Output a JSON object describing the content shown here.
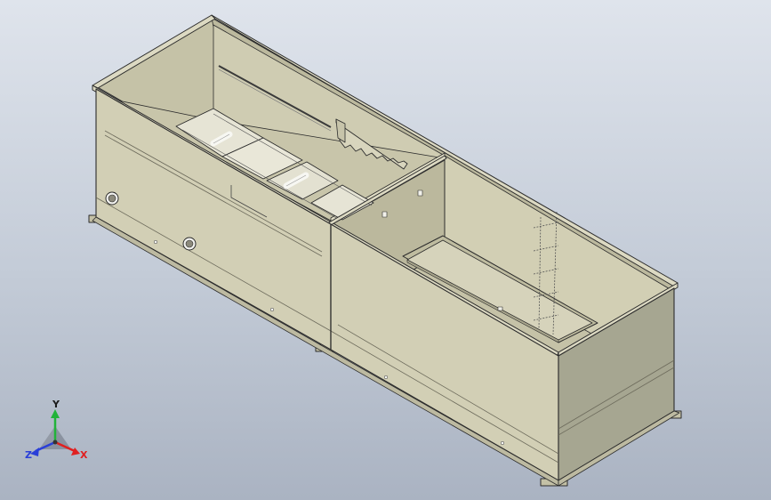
{
  "triad": {
    "x_label": "X",
    "y_label": "Y",
    "z_label": "Z",
    "x_color": "#e02020",
    "y_color": "#22b33a",
    "z_color": "#2a3fd8"
  },
  "model": {
    "body_color": "#d3d0b6",
    "side_color": "#cac7ad",
    "inner_color": "#c9c6ab",
    "edge_color": "#2c2c2c"
  }
}
